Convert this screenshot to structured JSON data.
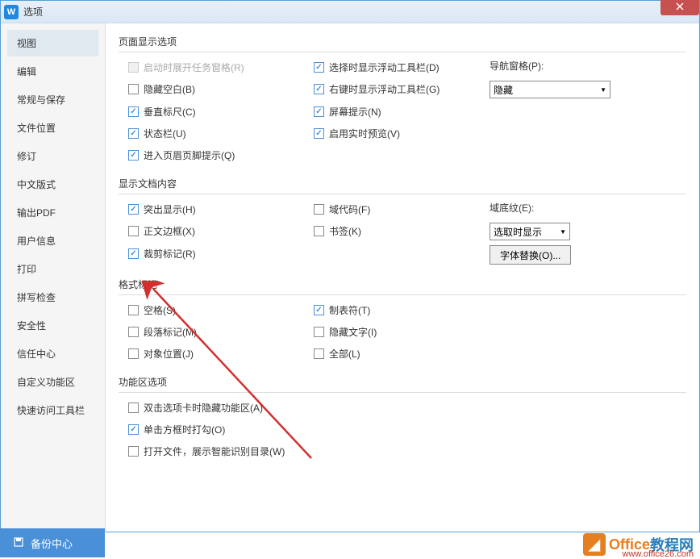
{
  "window": {
    "title": "选项"
  },
  "sidebar": {
    "items": [
      {
        "label": "视图",
        "active": true
      },
      {
        "label": "编辑"
      },
      {
        "label": "常规与保存"
      },
      {
        "label": "文件位置"
      },
      {
        "label": "修订"
      },
      {
        "label": "中文版式"
      },
      {
        "label": "输出PDF"
      },
      {
        "label": "用户信息"
      },
      {
        "label": "打印"
      },
      {
        "label": "拼写检查"
      },
      {
        "label": "安全性"
      },
      {
        "label": "信任中心"
      },
      {
        "label": "自定义功能区"
      },
      {
        "label": "快速访问工具栏"
      }
    ]
  },
  "sections": {
    "page_display": {
      "title": "页面显示选项",
      "startup_pane": "启动时展开任务窗格(R)",
      "hide_blank": "隐藏空白(B)",
      "vertical_ruler": "垂直标尺(C)",
      "status_bar": "状态栏(U)",
      "header_footer": "进入页眉页脚提示(Q)",
      "select_float": "选择时显示浮动工具栏(D)",
      "rightclick_float": "右键时显示浮动工具栏(G)",
      "screen_tip": "屏幕提示(N)",
      "live_preview": "启用实时预览(V)",
      "nav_pane_label": "导航窗格(P):",
      "nav_pane_value": "隐藏"
    },
    "doc_content": {
      "title": "显示文档内容",
      "highlight": "突出显示(H)",
      "text_border": "正文边框(X)",
      "crop_marks": "裁剪标记(R)",
      "field_codes": "域代码(F)",
      "bookmarks": "书签(K)",
      "field_shading_label": "域底纹(E):",
      "field_shading_value": "选取时显示",
      "font_replace": "字体替换(O)..."
    },
    "format_marks": {
      "title": "格式标记",
      "spaces": "空格(S)",
      "para_marks": "段落标记(M)",
      "object_pos": "对象位置(J)",
      "tabs": "制表符(T)",
      "hidden_text": "隐藏文字(I)",
      "all": "全部(L)"
    },
    "ribbon": {
      "title": "功能区选项",
      "dbl_click": "双击选项卡时隐藏功能区(A)",
      "click_check": "单击方框时打勾(O)",
      "open_smart": "打开文件，展示智能识别目录(W)"
    }
  },
  "footer": {
    "backup": "备份中心"
  },
  "watermark": {
    "brand1": "Office",
    "brand2": "教程网",
    "url": "www.office26.com"
  }
}
